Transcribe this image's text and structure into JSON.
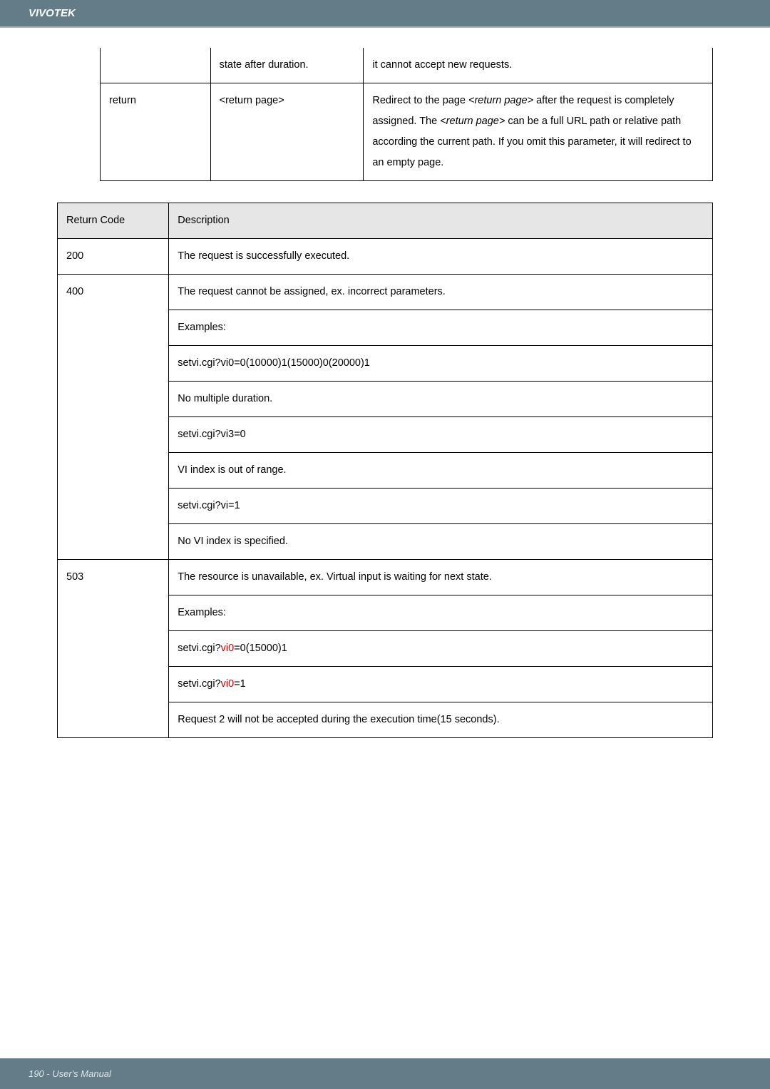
{
  "header": {
    "brand": "VIVOTEK"
  },
  "footer": {
    "text": "190 - User's Manual"
  },
  "table1": {
    "row1": {
      "c2": "state after duration.",
      "c3": "it cannot accept new requests."
    },
    "row2": {
      "c1": "return",
      "c2": "<return page>",
      "c3_pre1": "Redirect to the page ",
      "c3_i1": "<return page>",
      "c3_post1": " after the request is completely assigned. The ",
      "c3_i2": "<return page>",
      "c3_post2": " can be a full URL path or relative path according the current path. If you omit this parameter, it will redirect to an empty page."
    }
  },
  "table2": {
    "header": {
      "c1": "Return Code",
      "c2": "Description"
    },
    "r200": {
      "code": "200",
      "desc": "The request is successfully executed."
    },
    "r400": {
      "code": "400",
      "l1": "The request cannot be assigned, ex. incorrect parameters.",
      "l2": "Examples:",
      "l3": "setvi.cgi?vi0=0(10000)1(15000)0(20000)1",
      "l4": "No multiple duration.",
      "l5": "setvi.cgi?vi3=0",
      "l6": "VI index is out of range.",
      "l7": "setvi.cgi?vi=1",
      "l8": "No VI index is specified."
    },
    "r503": {
      "code": "503",
      "l1": "The resource is unavailable, ex. Virtual input is waiting for next state.",
      "l2": "Examples:",
      "l3a": "setvi.cgi?",
      "l3b": "vi0",
      "l3c": "=0(15000)1",
      "l4a": "setvi.cgi?",
      "l4b": "vi0",
      "l4c": "=1",
      "l5": "Request 2 will not be accepted during the execution time(15 seconds)."
    }
  }
}
